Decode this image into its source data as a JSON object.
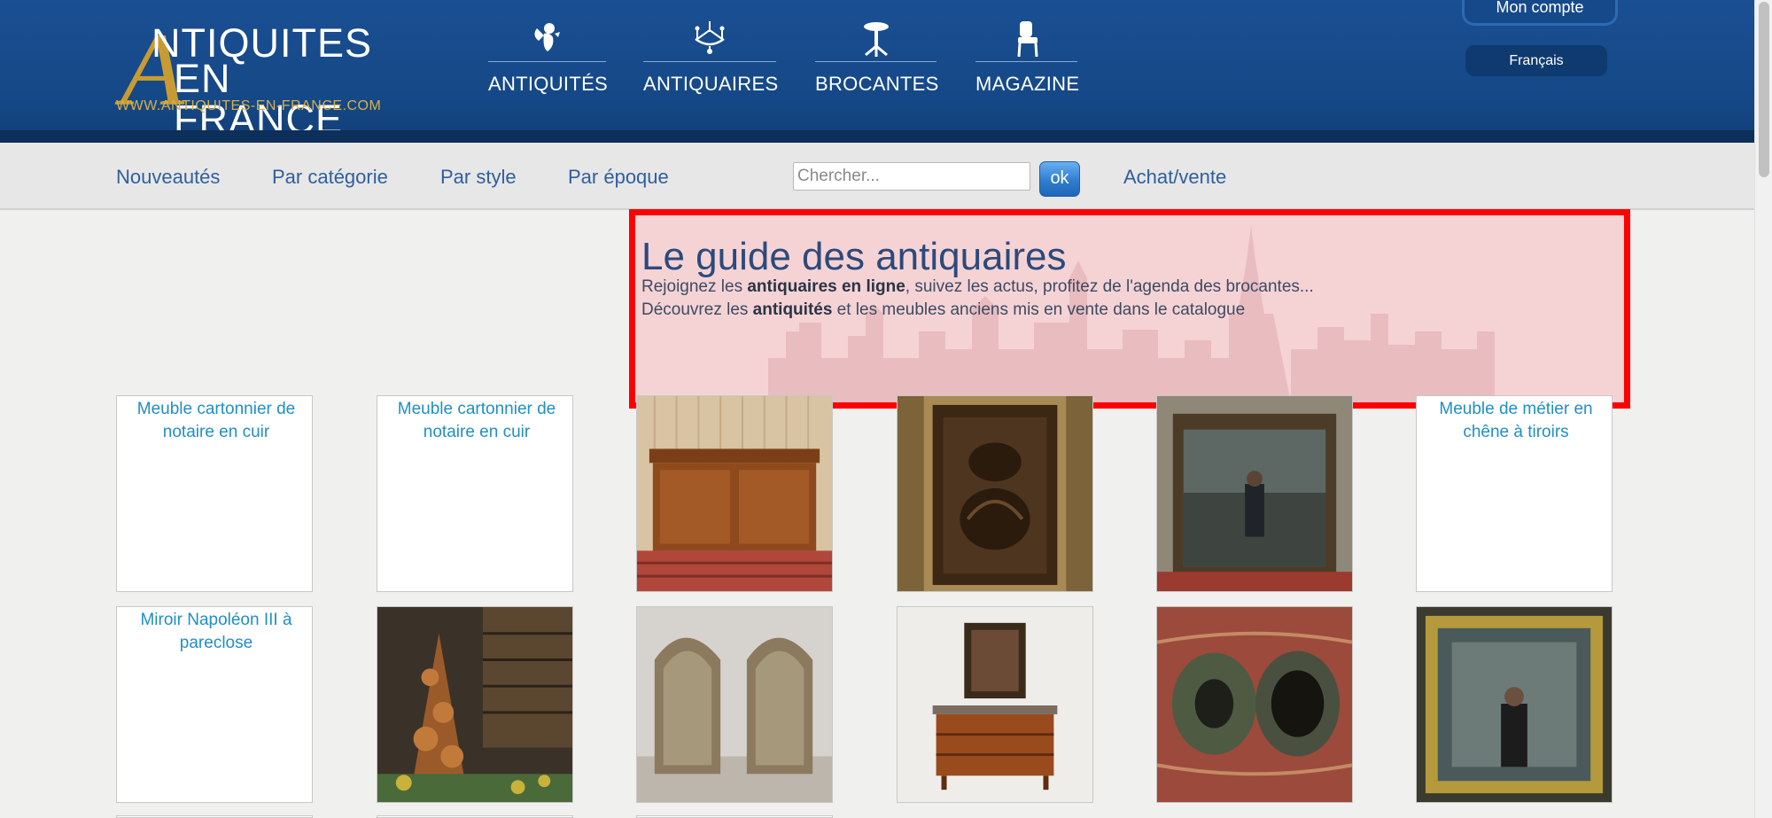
{
  "logo": {
    "big_letter": "A",
    "line1": "NTIQUITES",
    "line2": "EN FRANCE",
    "url": "WWW.ANTIQUITES-EN-FRANCE.COM"
  },
  "nav": [
    {
      "label": "ANTIQUITÉS",
      "icon": "cherub-icon"
    },
    {
      "label": "ANTIQUAIRES",
      "icon": "chandelier-icon"
    },
    {
      "label": "BROCANTES",
      "icon": "side-table-icon"
    },
    {
      "label": "MAGAZINE",
      "icon": "chair-icon"
    }
  ],
  "account": {
    "label": "Mon compte"
  },
  "language": {
    "label": "Français"
  },
  "subnav": {
    "links": [
      "Nouveautés",
      "Par catégorie",
      "Par style",
      "Par époque"
    ],
    "search_placeholder": "Chercher...",
    "ok_label": "ok",
    "buy_sell": "Achat/vente"
  },
  "hero": {
    "title": "Le guide des antiquaires",
    "line1_before": "Rejoignez les ",
    "line1_bold": "antiquaires en ligne",
    "line1_after": ", suivez les actus, profitez de l'agenda des brocantes...",
    "line2_before": "Découvrez les ",
    "line2_bold": "antiquités",
    "line2_after": " et les meubles anciens mis en vente dans le catalogue"
  },
  "colors": {
    "header_blue": "#1a4f93",
    "logo_gold": "#c89b32",
    "link_blue": "#2f5f9c",
    "alt_blue": "#1f8fc6",
    "highlight_red": "#ff0000"
  },
  "products": [
    {
      "alt": "Meuble cartonnier de notaire en cuir",
      "image": "broken-image-icon"
    },
    {
      "alt": "Meuble cartonnier de notaire en cuir",
      "image": "broken-image-icon"
    },
    {
      "alt": "",
      "image": "wooden-sideboard-photo"
    },
    {
      "alt": "",
      "image": "carved-wood-panel-photo"
    },
    {
      "alt": "",
      "image": "wooden-mirror-photo"
    },
    {
      "alt": "Meuble de métier en chêne à tiroirs",
      "image": "broken-image-icon"
    },
    {
      "alt": "Miroir Napoléon III à pareclose",
      "image": "broken-image-icon"
    },
    {
      "alt": "",
      "image": "copper-pots-library-photo"
    },
    {
      "alt": "",
      "image": "porter-armchairs-photo"
    },
    {
      "alt": "",
      "image": "marquetry-commode-photo"
    },
    {
      "alt": "",
      "image": "gramophone-horns-photo"
    },
    {
      "alt": "",
      "image": "gilded-mirror-photo"
    }
  ]
}
